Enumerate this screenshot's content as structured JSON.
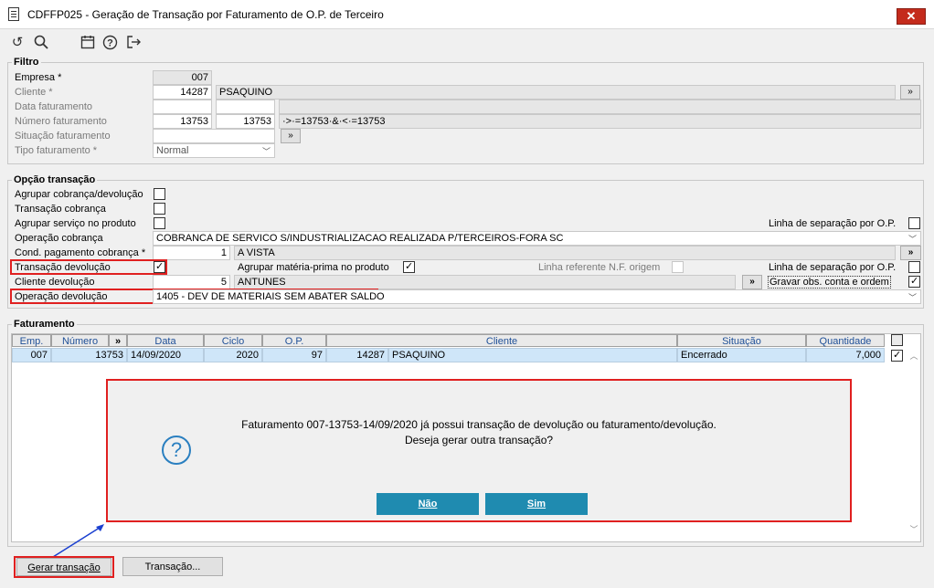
{
  "window": {
    "title": "CDFFP025 - Geração de Transação por Faturamento de O.P. de Terceiro",
    "close": "✕"
  },
  "toolbar": {
    "undo": "↺",
    "search": "🔍",
    "calendar": "📅",
    "help": "?",
    "exit": "⇥"
  },
  "filtro": {
    "title": "Filtro",
    "empresa_label": "Empresa *",
    "empresa_value": "007",
    "cliente_label": "Cliente *",
    "cliente_code": "14287",
    "cliente_name": "PSAQUINO",
    "cliente_btn": "»",
    "data_label": "Data faturamento",
    "numero_label": "Número faturamento",
    "numero_from": "13753",
    "numero_to": "13753",
    "numero_expr": "·>·=13753·&·<·=13753",
    "situacao_label": "Situação faturamento",
    "situacao_btn": "»",
    "tipo_label": "Tipo faturamento *",
    "tipo_value": "Normal"
  },
  "opcao": {
    "title": "Opção transação",
    "agrupar_cob_label": "Agrupar cobrança/devolução",
    "trans_cob_label": "Transação cobrança",
    "agrupar_serv_label": "Agrupar serviço no produto",
    "linha_sep1_label": "Linha de separação por O.P.",
    "op_cob_label": "Operação cobrança",
    "op_cob_value": "COBRANCA DE SERVICO S/INDUSTRIALIZACAO REALIZADA P/TERCEIROS-FORA SC",
    "cond_pag_label": "Cond. pagamento cobrança *",
    "cond_pag_code": "1",
    "cond_pag_name": "A VISTA",
    "cond_pag_btn": "»",
    "trans_dev_label": "Transação devolução",
    "agrupar_mp_label": "Agrupar matéria-prima no produto",
    "linha_ref_label": "Linha referente N.F. origem",
    "linha_sep2_label": "Linha de separação por O.P.",
    "cli_dev_label": "Cliente devolução",
    "cli_dev_code": "5",
    "cli_dev_name": "ANTUNES",
    "cli_dev_btn": "»",
    "gravar_obs_label": "Gravar obs. conta e ordem",
    "op_dev_label": "Operação devolução",
    "op_dev_value": "1405 - DEV DE MATERIAIS SEM ABATER SALDO"
  },
  "faturamento": {
    "title": "Faturamento",
    "headers": {
      "emp": "Emp.",
      "numero": "Número",
      "sort": "»",
      "data": "Data",
      "ciclo": "Ciclo",
      "op": "O.P.",
      "cliente": "Cliente",
      "situacao": "Situação",
      "quantidade": "Quantidade"
    },
    "row": {
      "emp": "007",
      "numero": "13753",
      "data": "14/09/2020",
      "ciclo": "2020",
      "op": "97",
      "cliente_code": "14287",
      "cliente_name": "PSAQUINO",
      "situacao": "Encerrado",
      "quantidade": "7,000"
    }
  },
  "dialog": {
    "line1": "Faturamento 007-13753-14/09/2020 já possui transação de devolução ou faturamento/devolução.",
    "line2": "Deseja gerar outra transação?",
    "icon": "?",
    "nao": "Não",
    "sim": "Sim"
  },
  "footer": {
    "gerar": "Gerar transação",
    "transacao": "Transação..."
  },
  "colors": {
    "accent": "#1f8bb0",
    "highlight": "#e02020",
    "selection": "#cfe6f9"
  }
}
